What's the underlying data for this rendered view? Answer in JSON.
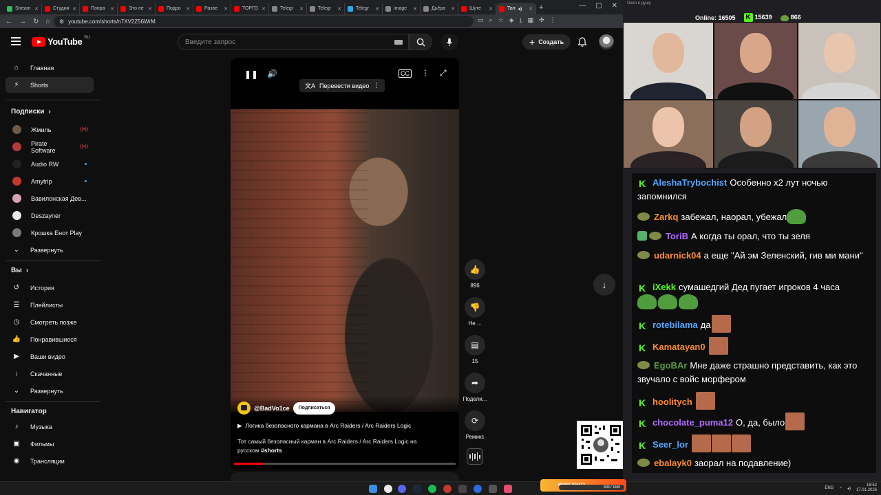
{
  "browser": {
    "tabs": [
      {
        "label": "Stream",
        "color": "#2dbe60"
      },
      {
        "label": "Студия",
        "color": "#ff0000"
      },
      {
        "label": "Понра",
        "color": "#ff0000"
      },
      {
        "label": "Это пе",
        "color": "#ff0000"
      },
      {
        "label": "Подро",
        "color": "#ff0000"
      },
      {
        "label": "Разве",
        "color": "#ff0000"
      },
      {
        "label": "ТОРГО",
        "color": "#ff0000"
      },
      {
        "label": "Telegr",
        "color": "#888888"
      },
      {
        "label": "Telegr",
        "color": "#888888"
      },
      {
        "label": "Telegr",
        "color": "#2aabee"
      },
      {
        "label": "image",
        "color": "#888888"
      },
      {
        "label": "Дьёра",
        "color": "#888888"
      },
      {
        "label": "Шуте",
        "color": "#ff0000"
      }
    ],
    "active_tab": {
      "label": "Тол",
      "color": "#ff0000"
    },
    "url": "youtube.com/shorts/n7XV2Z56WrM",
    "window_controls": [
      "—",
      "▢",
      "✕"
    ]
  },
  "youtube": {
    "logo_word": "YouTube",
    "logo_region": "RU",
    "search_placeholder": "Введите запрос",
    "create_label": "Создать",
    "sidebar": {
      "main": [
        {
          "label": "Главная",
          "icon": "home-icon",
          "glyph": "⌂"
        },
        {
          "label": "Shorts",
          "icon": "shorts-icon",
          "glyph": "⚡"
        }
      ],
      "subscriptions_header": "Подписки",
      "subscriptions": [
        {
          "label": "Жмиль",
          "color": "#6d5a4a",
          "status": "live"
        },
        {
          "label": "Pirate Software",
          "color": "#b23a3a",
          "status": "live"
        },
        {
          "label": "Audio RW",
          "color": "#222222",
          "status": "dot"
        },
        {
          "label": "Amytrip",
          "color": "#c0392b",
          "status": "dot"
        },
        {
          "label": "Вавилонская Дев...",
          "color": "#d4a3b3",
          "status": ""
        },
        {
          "label": "Deszayner",
          "color": "#e8e8e8",
          "status": ""
        },
        {
          "label": "Крошка Енот Play",
          "color": "#7a7a7a",
          "status": ""
        }
      ],
      "expand_label": "Развернуть",
      "you_header": "Вы",
      "you": [
        {
          "label": "История",
          "glyph": "↺"
        },
        {
          "label": "Плейлисты",
          "glyph": "☰"
        },
        {
          "label": "Смотреть позже",
          "glyph": "◷"
        },
        {
          "label": "Понравившиеся",
          "glyph": "👍"
        },
        {
          "label": "Ваши видео",
          "glyph": "▶"
        },
        {
          "label": "Скачанные",
          "glyph": "↓"
        }
      ],
      "you_expand_label": "Развернуть",
      "navigator_header": "Навигатор",
      "navigator": [
        {
          "label": "Музыка",
          "glyph": "♪"
        },
        {
          "label": "Фильмы",
          "glyph": "▣"
        },
        {
          "label": "Трансляции",
          "glyph": "◉"
        }
      ]
    },
    "short": {
      "translate_label": "Перевести видео",
      "channel": "@BadVo1ce",
      "subscribe_label": "Подписаться",
      "title": "Логика безопасного кармана в Arc Raiders / Arc Raiders Logic",
      "description": "Тот самый безопасный карман в Arc Raiders / Arc Raiders Logic на русском",
      "hashtag": "#shorts",
      "progress": 0.13
    },
    "actions": {
      "likes": "896",
      "dislike_label": "Не ...",
      "comments": "15",
      "share_label": "Подели...",
      "remix_label": "Ремикс"
    }
  },
  "stream_overlay": {
    "window_title": "Окно в душу",
    "online_label": "Online:",
    "online_count": "16505",
    "kick_count": "15639",
    "pepe_count": "866",
    "chat": [
      {
        "badge": "kick",
        "nick": "AleshaTrybochist",
        "nick_color": "#53a7ff",
        "text": "Особенно x2 лут ночью запомнился"
      },
      {
        "badge": "pepe",
        "nick": "Zarkq",
        "nick_color": "#ff8c2a",
        "text": "забежал, наорал, убежал"
      },
      {
        "badge": "shield-pepe",
        "nick": "ToriB",
        "nick_color": "#b36bff",
        "text": "А когда ты орал, что ты зеля"
      },
      {
        "badge": "pepe",
        "nick": "udarnick04",
        "nick_color": "#ff8c2a",
        "text": "а еще \"Ай эм Зеленский, гив ми мани\""
      },
      {
        "badge": "kick",
        "nick": "iXekk",
        "nick_color": "#53fc18",
        "text": "сумашедгий Дед пугает игроков 4 часа"
      },
      {
        "badge": "kick",
        "nick": "rotebilama",
        "nick_color": "#53a7ff",
        "text": "да"
      },
      {
        "badge": "kick",
        "nick": "Kamatayan0",
        "nick_color": "#ff8c2a",
        "text": ""
      },
      {
        "badge": "pepe",
        "nick": "EgoBAr",
        "nick_color": "#5b9b3d",
        "text": "Мне даже страшно представить, как это звучало с войс морфером"
      },
      {
        "badge": "kick",
        "nick": "hoolitych",
        "nick_color": "#ff8c2a",
        "text": ""
      },
      {
        "badge": "kick",
        "nick": "chocolate_puma12",
        "nick_color": "#b36bff",
        "text": "О, да, было"
      },
      {
        "badge": "kick",
        "nick": "Seer_lor",
        "nick_color": "#53a7ff",
        "text": ""
      },
      {
        "badge": "pepe",
        "nick": "ebalayk0",
        "nick_color": "#ff8c2a",
        "text": "заорал на подавление)"
      }
    ],
    "meme_party_label": "MEME PARTY",
    "meme_party_progress": "600 / 1500"
  },
  "taskbar": {
    "lang": "ENG",
    "time": "18:52",
    "date": "17.01.2026"
  }
}
